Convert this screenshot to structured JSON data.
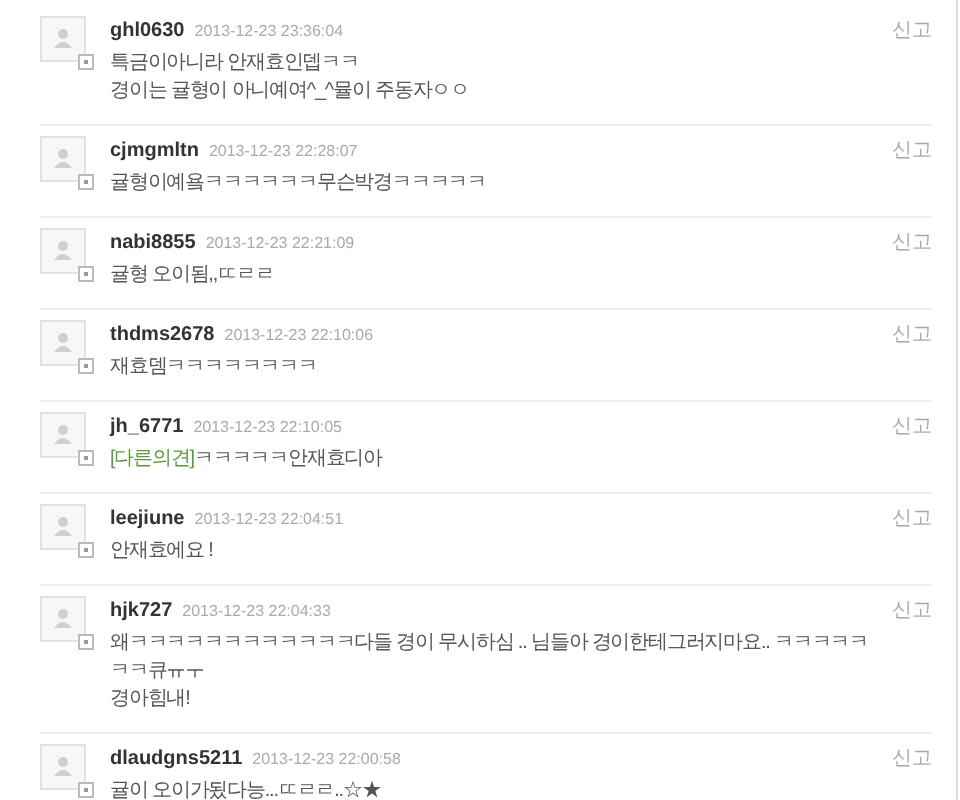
{
  "comments": [
    {
      "user": "ghl0630",
      "time": "2013-12-23 23:36:04",
      "report": "신고",
      "lines": [
        "특금이아니라 안재효인뎁ㅋㅋ",
        "경이는 귤형이 아니예여^_^뮬이 주동자ㅇㅇ"
      ]
    },
    {
      "user": "cjmgmltn",
      "time": "2013-12-23 22:28:07",
      "report": "신고",
      "lines": [
        "귤형이예욬ㅋㅋㅋㅋㅋㅋ무슨박경ㅋㅋㅋㅋㅋ"
      ]
    },
    {
      "user": "nabi8855",
      "time": "2013-12-23 22:21:09",
      "report": "신고",
      "lines": [
        "귤형 오이됨,,ㄸㄹㄹ"
      ]
    },
    {
      "user": "thdms2678",
      "time": "2013-12-23 22:10:06",
      "report": "신고",
      "lines": [
        "재효뎀ㅋㅋㅋㅋㅋㅋㅋㅋ"
      ]
    },
    {
      "user": "jh_6771",
      "time": "2013-12-23 22:10:05",
      "report": "신고",
      "tag": "[다른의견]",
      "lines": [
        "ㅋㅋㅋㅋㅋ안재효디아"
      ]
    },
    {
      "user": "leejiune",
      "time": "2013-12-23 22:04:51",
      "report": "신고",
      "lines": [
        "안재효에요 !"
      ]
    },
    {
      "user": "hjk727",
      "time": "2013-12-23 22:04:33",
      "report": "신고",
      "lines": [
        "왜ㅋㅋㅋㅋㅋㅋㅋㅋㅋㅋㅋㅋ다들 경이 무시하심 .. 님들아 경이한테그러지마요.. ㅋㅋㅋㅋㅋㅋㅋ큐ㅠㅜ",
        "경아힘내!"
      ]
    },
    {
      "user": "dlaudgns5211",
      "time": "2013-12-23 22:00:58",
      "report": "신고",
      "lines": [
        "귤이 오이가됬다능...ㄸㄹㄹ..☆★"
      ]
    }
  ]
}
